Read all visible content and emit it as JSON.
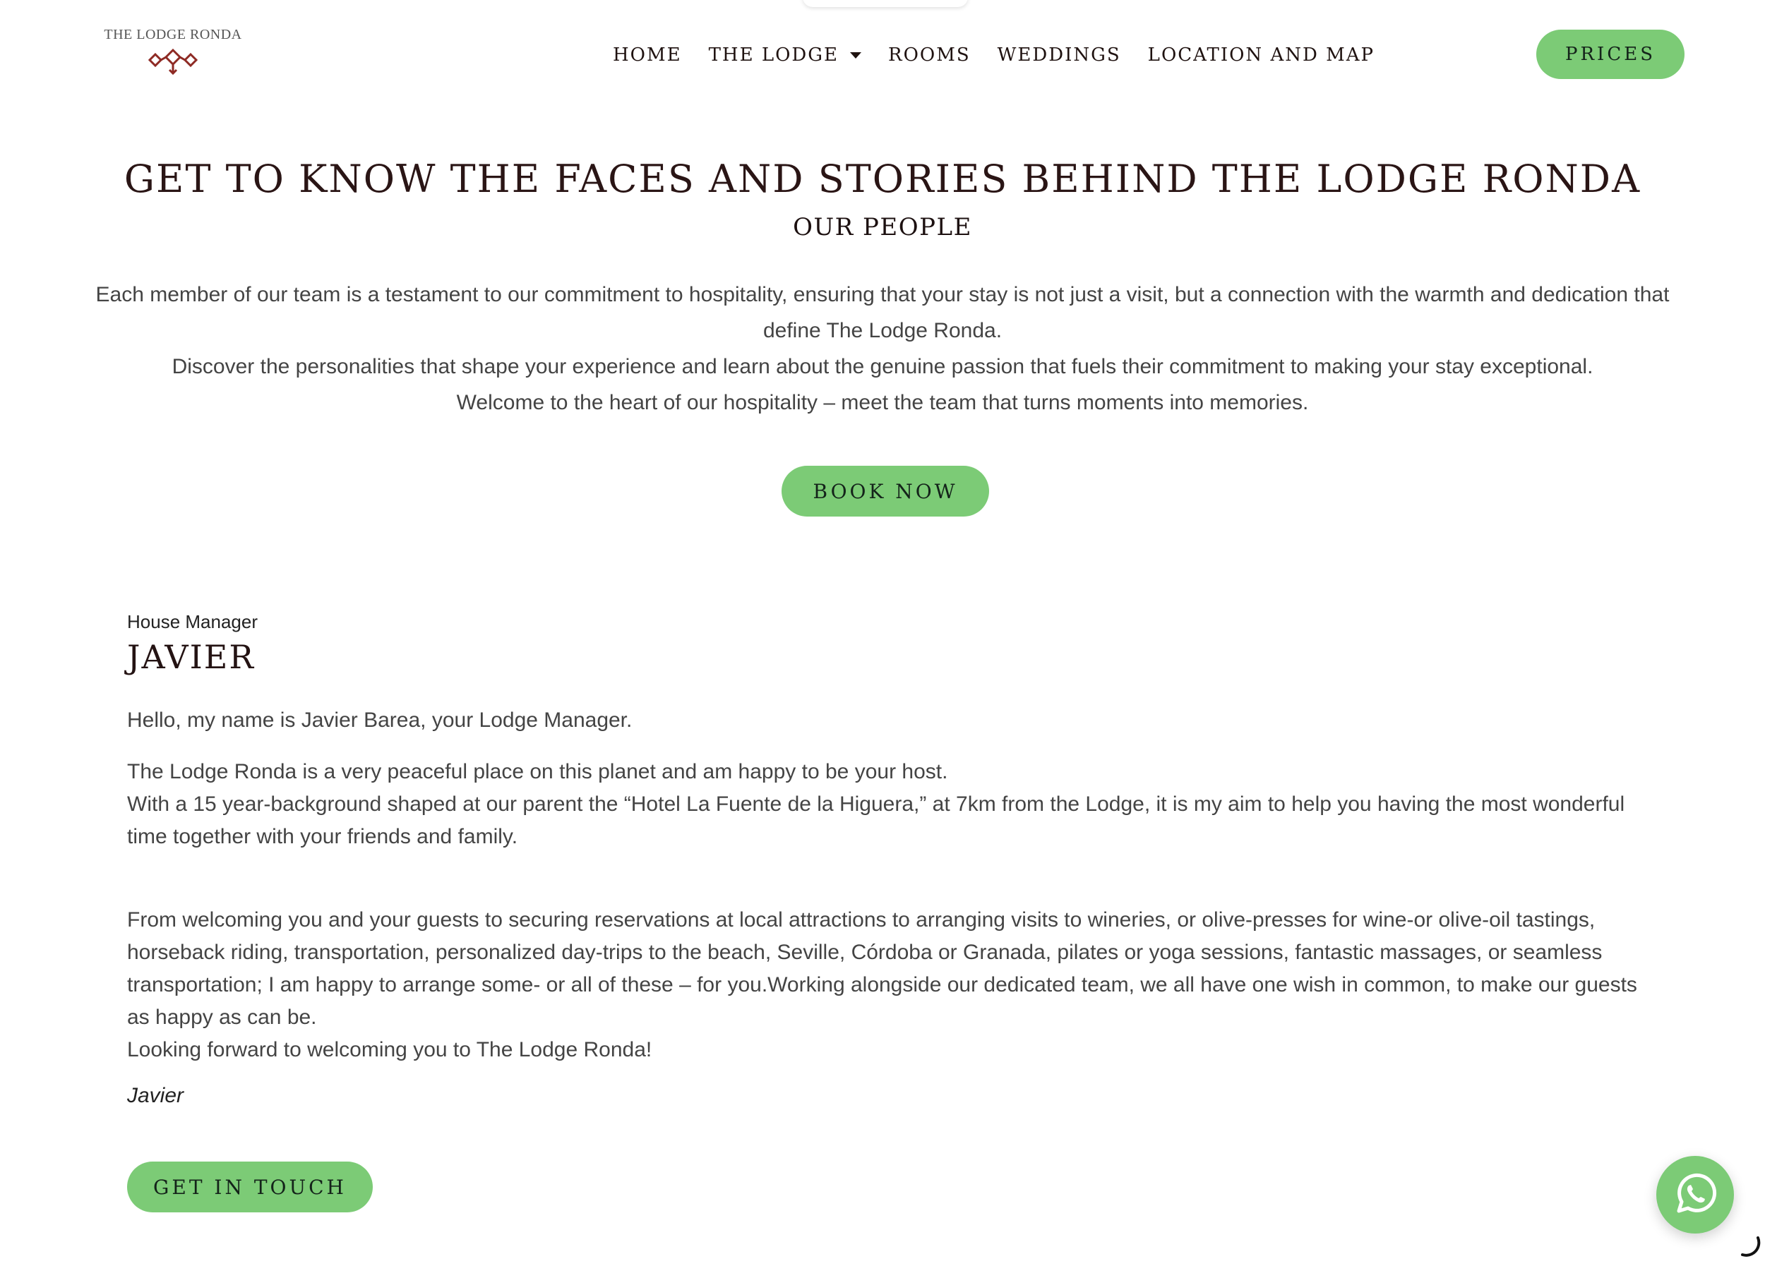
{
  "header": {
    "logo_text": "THE LODGE RONDA",
    "nav": [
      {
        "label": "HOME"
      },
      {
        "label": "THE LODGE",
        "has_dropdown": true
      },
      {
        "label": "ROOMS"
      },
      {
        "label": "WEDDINGS"
      },
      {
        "label": "LOCATION AND MAP"
      }
    ],
    "cta_label": "PRICES"
  },
  "hero": {
    "title": "GET TO KNOW THE FACES AND STORIES BEHIND THE LODGE RONDA",
    "subtitle": "OUR PEOPLE",
    "paragraphs": [
      "Each member of our team is a testament to our commitment to hospitality, ensuring that your stay is not just a visit, but a connection with the warmth and dedication that define The Lodge Ronda.",
      "Discover the personalities that shape your experience and learn about the genuine passion that fuels their commitment to making your stay exceptional.",
      "Welcome to the heart of our hospitality – meet the team that turns moments into memories."
    ],
    "book_label": "BOOK NOW"
  },
  "person": {
    "role": "House Manager",
    "name": "JAVIER",
    "bio_1": "Hello, my name is Javier Barea, your Lodge Manager.",
    "bio_2": "The Lodge Ronda is a very peaceful place on this planet and am happy to be your host.",
    "bio_3": "With a 15 year-background shaped at our parent the “Hotel La Fuente de la Higuera,” at 7km from the Lodge, it is my aim to help you having the most wonderful time together with your friends and family.",
    "bio_4": "From welcoming you and your guests to securing reservations at local attractions to arranging visits to wineries, or olive-presses for wine-or olive-oil tastings, horseback riding, transportation, personalized day-trips to the beach, Seville, Córdoba or Granada, pilates or yoga sessions, fantastic massages, or seamless transportation; I am happy to arrange some- or all of these – for you.Working alongside our dedicated team, we all have one wish in common, to make our guests as happy as can be.",
    "bio_5": "Looking forward to welcoming you to The Lodge Ronda!",
    "signature": "Javier",
    "contact_label": "GET IN TOUCH"
  },
  "colors": {
    "accent_green": "#7ccb76",
    "heading_dark": "#2a1515",
    "logo_red": "#8e2a24",
    "body_text": "#444444"
  },
  "icons": {
    "logo_mark": "lodge-ornament-icon",
    "dropdown": "chevron-down-icon",
    "chat": "whatsapp-icon",
    "loading": "spinner-icon"
  }
}
